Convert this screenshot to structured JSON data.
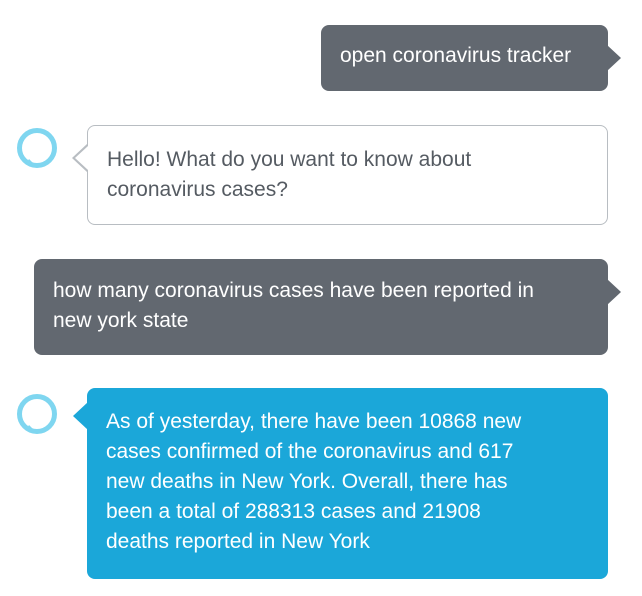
{
  "colors": {
    "user_bubble": "#626870",
    "alexa_outline_border": "#b8bdc2",
    "alexa_outline_text": "#555b62",
    "alexa_filled": "#1ba7d9",
    "alexa_icon": "#7fd6f0"
  },
  "conversation": [
    {
      "speaker": "user",
      "text": "open coronavirus tracker"
    },
    {
      "speaker": "alexa",
      "icon": "alexa-ring-icon",
      "text": "Hello! What do you want to know about\ncoronavirus cases?"
    },
    {
      "speaker": "user",
      "text": "how many coronavirus cases have been reported in\nnew york state"
    },
    {
      "speaker": "alexa",
      "icon": "alexa-ring-icon",
      "text": "As of yesterday, there have been 10868 new\ncases confirmed of the coronavirus and 617\nnew deaths in New York. Overall, there has\nbeen a total of 288313 cases and 21908\ndeaths reported in New York"
    }
  ]
}
